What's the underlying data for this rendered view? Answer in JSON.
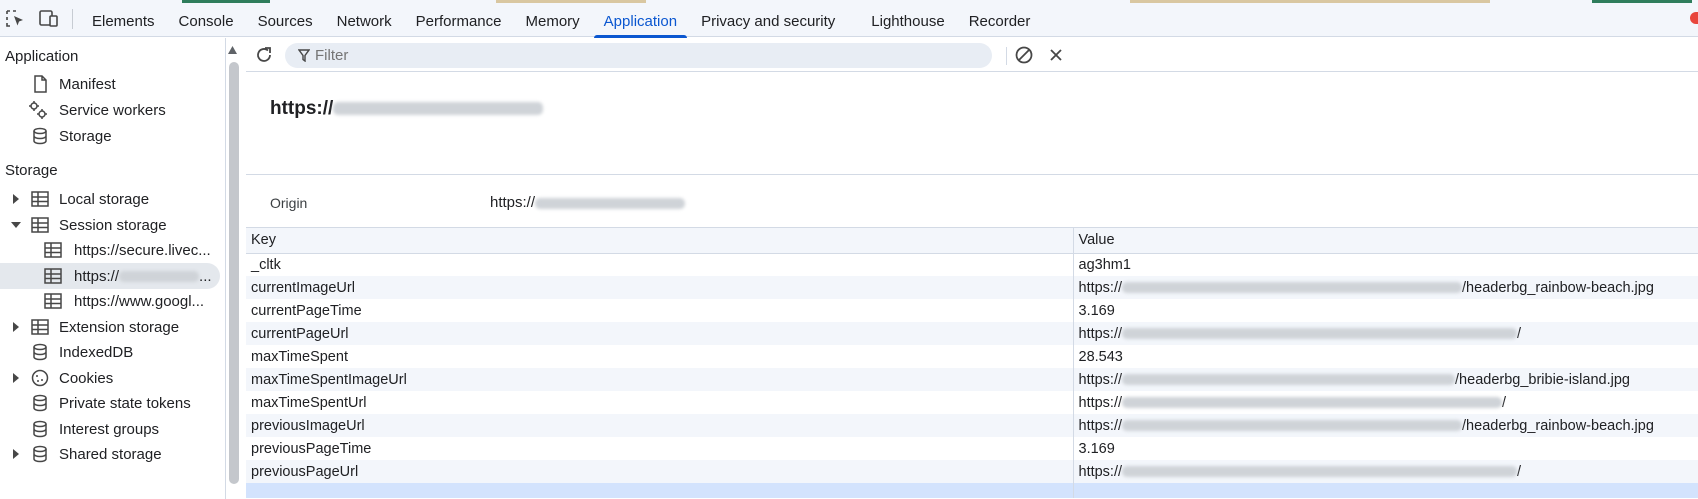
{
  "tabs": [
    "Elements",
    "Console",
    "Sources",
    "Network",
    "Performance",
    "Memory",
    "Application",
    "Privacy and security",
    "Lighthouse",
    "Recorder"
  ],
  "active_tab": "Application",
  "sidebar": {
    "application_header": "Application",
    "application_items": [
      {
        "label": "Manifest",
        "icon": "document-icon"
      },
      {
        "label": "Service workers",
        "icon": "gears-icon"
      },
      {
        "label": "Storage",
        "icon": "database-icon"
      }
    ],
    "storage_header": "Storage",
    "storage_items": [
      {
        "label": "Local storage",
        "icon": "table-icon",
        "arrow": "right"
      },
      {
        "label": "Session storage",
        "icon": "table-icon",
        "arrow": "down"
      },
      {
        "label": "https://secure.livec...",
        "icon": "table-icon",
        "indent": true
      },
      {
        "label": "https://",
        "icon": "table-icon",
        "indent": true,
        "selected": true,
        "redacted": true
      },
      {
        "label": "https://www.googl...",
        "icon": "table-icon",
        "indent": true
      },
      {
        "label": "Extension storage",
        "icon": "table-icon",
        "arrow": "right"
      },
      {
        "label": "IndexedDB",
        "icon": "database-icon"
      },
      {
        "label": "Cookies",
        "icon": "cookie-icon",
        "arrow": "right"
      },
      {
        "label": "Private state tokens",
        "icon": "database-icon"
      },
      {
        "label": "Interest groups",
        "icon": "database-icon"
      },
      {
        "label": "Shared storage",
        "icon": "database-icon",
        "arrow": "right"
      }
    ]
  },
  "toolbar": {
    "filter_placeholder": "Filter"
  },
  "origin": {
    "title": "https://",
    "label": "Origin",
    "value": "https://"
  },
  "table": {
    "headers": {
      "key": "Key",
      "value": "Value"
    },
    "rows": [
      {
        "key": "_cltk",
        "value": "ag3hm1",
        "blur": 0,
        "suffix": ""
      },
      {
        "key": "currentImageUrl",
        "value": "https://",
        "blur": 340,
        "suffix": "/headerbg_rainbow-beach.jpg"
      },
      {
        "key": "currentPageTime",
        "value": "3.169",
        "blur": 0,
        "suffix": ""
      },
      {
        "key": "currentPageUrl",
        "value": "https://",
        "blur": 395,
        "suffix": "/"
      },
      {
        "key": "maxTimeSpent",
        "value": "28.543",
        "blur": 0,
        "suffix": ""
      },
      {
        "key": "maxTimeSpentImageUrl",
        "value": "https://",
        "blur": 333,
        "suffix": "/headerbg_bribie-island.jpg"
      },
      {
        "key": "maxTimeSpentUrl",
        "value": "https://",
        "blur": 380,
        "suffix": "/"
      },
      {
        "key": "previousImageUrl",
        "value": "https://",
        "blur": 340,
        "suffix": "/headerbg_rainbow-beach.jpg"
      },
      {
        "key": "previousPageTime",
        "value": "3.169",
        "blur": 0,
        "suffix": ""
      },
      {
        "key": "previousPageUrl",
        "value": "https://",
        "blur": 395,
        "suffix": "/"
      }
    ]
  },
  "colors": {
    "accent": "#0b57d0",
    "row_alt": "#f3f6fb",
    "selection": "#d3e3fd"
  }
}
